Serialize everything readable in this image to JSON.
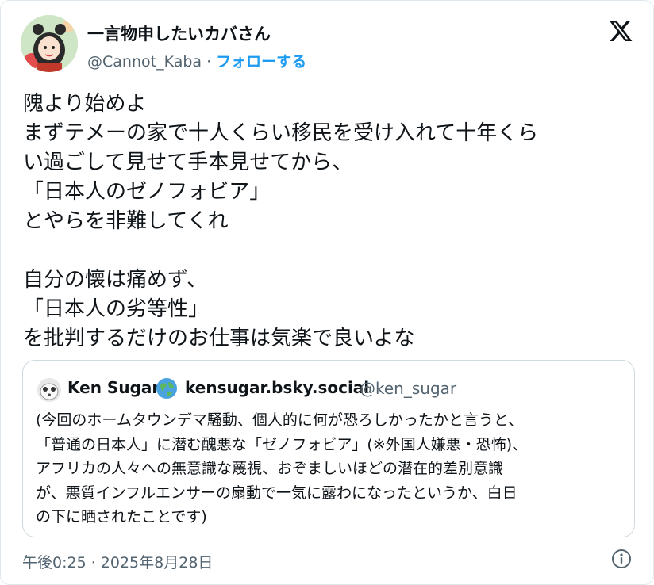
{
  "author": {
    "display_name": "一言物申したいカバさん",
    "handle": "@Cannot_Kaba",
    "separator": " · ",
    "follow_label": "フォローする"
  },
  "brand": {
    "icon": "x-logo-icon"
  },
  "tweet": {
    "lines": [
      "隗より始めよ",
      "まずテメーの家で十人くらい移民を受け入れて十年くら",
      "い過ごして見せて手本見せてから、",
      "「日本人のゼノフォビア」",
      "とやらを非難してくれ",
      "",
      "自分の懐は痛めず、",
      "「日本人の劣等性」",
      "を批判するだけのお仕事は気楽で良いよな"
    ]
  },
  "quote": {
    "name": "Ken Sugar",
    "domain": "kensugar.bsky.social",
    "handle": "@ken_sugar",
    "globe_icon": "globe-icon",
    "lines": [
      "(今回のホームタウンデマ騒動、個人的に何が恐ろしかったかと言うと、",
      "「普通の日本人」に潜む醜悪な「ゼノフォビア」(※外国人嫌悪・恐怖)、",
      "アフリカの人々への無意識な蔑視、おぞましいほどの潜在的差別意識",
      "が、悪質インフルエンサーの扇動で一気に露わになったというか、白日",
      "の下に晒されたことです)"
    ]
  },
  "timestamp": "午後0:25 · 2025年8月28日",
  "info_icon": "info-icon",
  "colors": {
    "link": "#1d9bf0",
    "muted": "#536471",
    "text": "#0f1419",
    "border": "#cfd9de"
  }
}
